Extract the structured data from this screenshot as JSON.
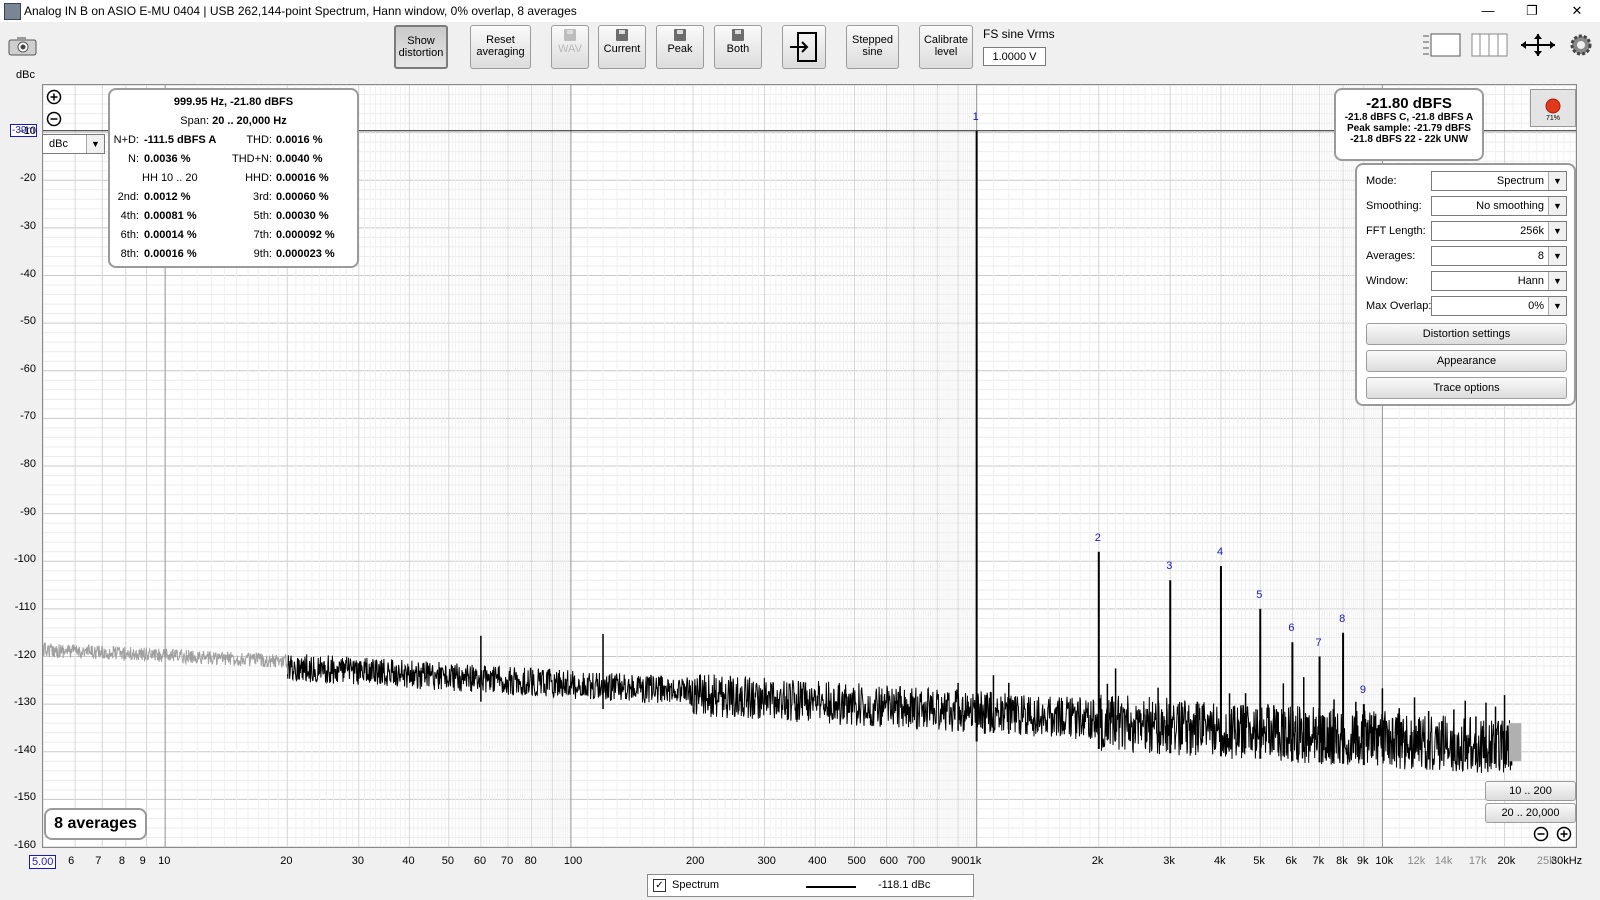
{
  "window": {
    "title": "Analog IN B on ASIO E-MU 0404 | USB 262,144-point Spectrum, Hann window, 0% overlap, 8 averages",
    "minimize": "—",
    "restore": "❐",
    "close": "✕"
  },
  "toolbar": {
    "show_distortion": [
      "Show",
      "distortion"
    ],
    "reset_averaging": [
      "Reset",
      "averaging"
    ],
    "wav": "WAV",
    "current": "Current",
    "peak": "Peak",
    "both": "Both",
    "stepped_sine": [
      "Stepped",
      "sine"
    ],
    "calibrate_level": [
      "Calibrate",
      "level"
    ],
    "fs_sine_label": "FS sine Vrms",
    "fs_sine_value": "1.0000 V"
  },
  "axis": {
    "y_unit": "dBc",
    "y_unit_selector": "dBc",
    "ref_level_marker": "-39m",
    "y_ticks": [
      "-10",
      "-20",
      "-30",
      "-40",
      "-50",
      "-60",
      "-70",
      "-80",
      "-90",
      "-100",
      "-110",
      "-120",
      "-130",
      "-140",
      "-150",
      "-160"
    ],
    "x_ticks": [
      "5.00",
      "6",
      "7",
      "8",
      "9",
      "10",
      "20",
      "30",
      "40",
      "50",
      "60",
      "70",
      "80",
      "100",
      "200",
      "300",
      "400",
      "500",
      "600",
      "700",
      "900",
      "1k",
      "2k",
      "3k",
      "4k",
      "5k",
      "6k",
      "7k",
      "8k",
      "9k",
      "10k",
      "12k",
      "14k",
      "17k",
      "20k",
      "25k",
      "30kHz"
    ]
  },
  "distortion_panel": {
    "header": "999.95 Hz, -21.80 dBFS",
    "span_label": "Span:",
    "span_value": "20 .. 20,000 Hz",
    "rows": [
      {
        "l_label": "N+D:",
        "l_value": "-111.5 dBFS A",
        "r_label": "THD:",
        "r_value": "0.0016 %"
      },
      {
        "l_label": "N:",
        "l_value": "0.0036 %",
        "r_label": "THD+N:",
        "r_value": "0.0040 %"
      },
      {
        "l_label": "HH 10 .. 20",
        "l_value": "",
        "r_label": "HHD:",
        "r_value": "0.00016 %"
      },
      {
        "l_label": "2nd:",
        "l_value": "0.0012 %",
        "r_label": "3rd:",
        "r_value": "0.00060 %"
      },
      {
        "l_label": "4th:",
        "l_value": "0.00081 %",
        "r_label": "5th:",
        "r_value": "0.00030 %"
      },
      {
        "l_label": "6th:",
        "l_value": "0.00014 %",
        "r_label": "7th:",
        "r_value": "0.000092 %"
      },
      {
        "l_label": "8th:",
        "l_value": "0.00016 %",
        "r_label": "9th:",
        "r_value": "0.000023 %"
      }
    ]
  },
  "level_panel": {
    "main": "-21.80 dBFS",
    "line1": "-21.8 dBFS C, -21.8 dBFS A",
    "line2": "Peak sample: -21.79 dBFS",
    "line3": "-21.8 dBFS 22 - 22k UNW"
  },
  "record_badge": "71%",
  "settings_panel": {
    "rows": [
      {
        "label": "Mode:",
        "value": "Spectrum"
      },
      {
        "label": "Smoothing:",
        "value": "No  smoothing"
      },
      {
        "label": "FFT Length:",
        "value": "256k"
      },
      {
        "label": "Averages:",
        "value": "8"
      },
      {
        "label": "Window:",
        "value": "Hann"
      },
      {
        "label": "Max Overlap:",
        "value": "0%"
      }
    ],
    "buttons": [
      "Distortion settings",
      "Appearance",
      "Trace options"
    ]
  },
  "averages_badge": "8 averages",
  "range_buttons": [
    "10 .. 200",
    "20 .. 20,000"
  ],
  "legend": {
    "series_name": "Spectrum",
    "series_value": "-118.1 dBc"
  },
  "harmonic_markers": [
    "1",
    "2",
    "3",
    "4",
    "5",
    "6",
    "7",
    "8",
    "9"
  ],
  "chart_data": {
    "type": "line",
    "ylabel": "dBc",
    "xscale": "log",
    "xlim": [
      5,
      30000
    ],
    "ylim": [
      -160,
      0
    ],
    "grid": true,
    "series": [
      {
        "name": "Spectrum",
        "color": "#000000"
      }
    ],
    "peaks": [
      {
        "label": "1",
        "freq_hz": 1000,
        "level": 0
      },
      {
        "label": "2",
        "freq_hz": 2000,
        "level": -98
      },
      {
        "label": "3",
        "freq_hz": 3000,
        "level": -104
      },
      {
        "label": "4",
        "freq_hz": 4000,
        "level": -101
      },
      {
        "label": "5",
        "freq_hz": 5000,
        "level": -110
      },
      {
        "label": "6",
        "freq_hz": 6000,
        "level": -117
      },
      {
        "label": "7",
        "freq_hz": 7000,
        "level": -120
      },
      {
        "label": "8",
        "freq_hz": 8000,
        "level": -115
      },
      {
        "label": "9",
        "freq_hz": 9000,
        "level": -130
      }
    ]
  }
}
